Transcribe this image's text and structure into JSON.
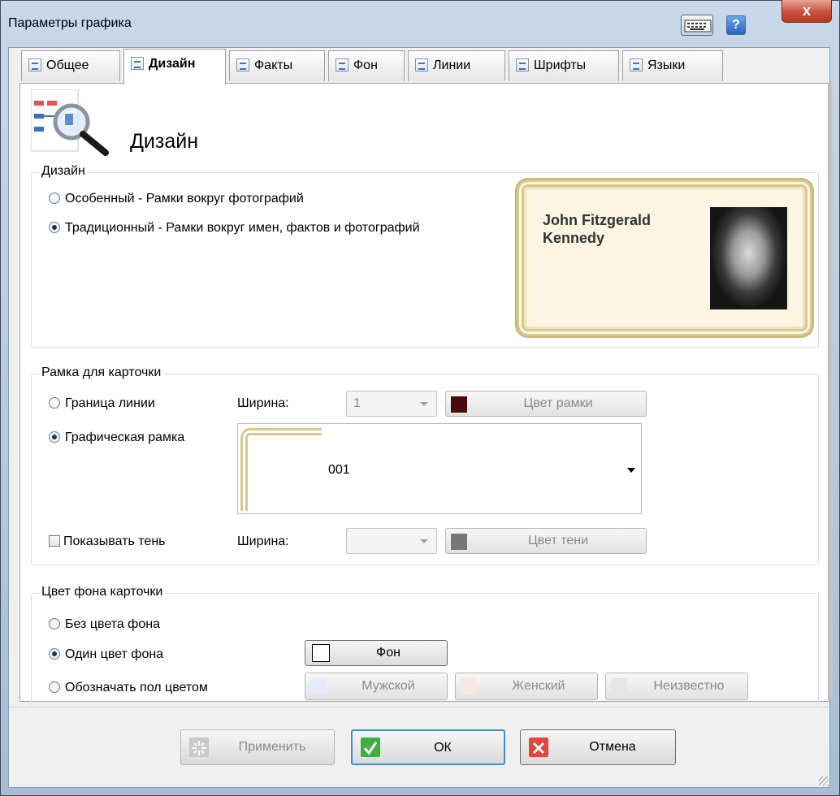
{
  "window": {
    "title": "Параметры графика",
    "help_label": "?",
    "close_label": "x"
  },
  "tabs": [
    {
      "label": "Общее"
    },
    {
      "label": "Дизайн"
    },
    {
      "label": "Факты"
    },
    {
      "label": "Фон"
    },
    {
      "label": "Линии"
    },
    {
      "label": "Шрифты"
    },
    {
      "label": "Языки"
    }
  ],
  "page": {
    "heading": "Дизайн"
  },
  "design_group": {
    "label": "Дизайн",
    "options": [
      {
        "label": "Особенный - Рамки вокруг фотографий",
        "selected": false
      },
      {
        "label": "Традиционный - Рамки вокруг имен, фактов и фотографий",
        "selected": true
      }
    ],
    "preview_name": "John Fitzgerald Kennedy"
  },
  "card_frame_group": {
    "label": "Рамка для карточки",
    "line_border_label": "Граница линии",
    "line_border_selected": false,
    "graphic_frame_label": "Графическая рамка",
    "graphic_frame_selected": true,
    "width_label": "Ширина:",
    "width_value": "1",
    "frame_color_label": "Цвет рамки",
    "frame_color": "#4a0a0a",
    "frame_value": "001",
    "show_shadow_label": "Показывать тень",
    "show_shadow_checked": false,
    "shadow_width_label": "Ширина:",
    "shadow_width_value": "",
    "shadow_color_label": "Цвет тени",
    "shadow_color": "#777777"
  },
  "card_bg_group": {
    "label": "Цвет фона карточки",
    "options": [
      {
        "label": "Без цвета фона",
        "selected": false
      },
      {
        "label": "Один цвет фона",
        "selected": true
      },
      {
        "label": "Обозначать пол цветом",
        "selected": false
      }
    ],
    "bg_button_label": "Фон",
    "bg_color": "#ffffff",
    "male_label": "Мужской",
    "male_color": "#e3ebf8",
    "female_label": "Женский",
    "female_color": "#f8e6e3",
    "unknown_label": "Неизвестно",
    "unknown_color": "#e6e6e6"
  },
  "footer": {
    "apply_label": "Применить",
    "ok_label": "ОК",
    "cancel_label": "Отмена"
  }
}
